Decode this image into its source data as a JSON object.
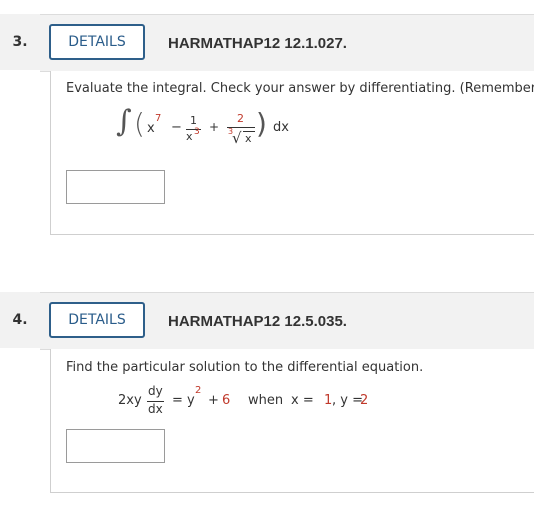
{
  "questions": [
    {
      "number": "3.",
      "details_label": "DETAILS",
      "id": "HARMATHAP12 12.1.027.",
      "prompt": "Evaluate the integral. Check your answer by differentiating. (Remember",
      "integral": {
        "sign": "∫",
        "lparen": "(",
        "rparen": ")",
        "x": "x",
        "exp7": "7",
        "minus": "−",
        "one": "1",
        "x3_base": "x",
        "x3_exp": "3",
        "plus": "+",
        "two": "2",
        "root_index": "3",
        "radical": "√",
        "root_x": "x",
        "dx": "dx"
      }
    },
    {
      "number": "4.",
      "details_label": "DETAILS",
      "id": "HARMATHAP12 12.5.035.",
      "prompt": "Find the particular solution to the differential equation.",
      "equation": {
        "lhs": "2xy",
        "dy": "dy",
        "dx": "dx",
        "eq": "=",
        "y": "y",
        "exp": "2",
        "plus": "+",
        "six": "6",
        "when": "when",
        "x_eq": "x = ",
        "x_val": "1",
        "comma": ", y = ",
        "y_val": "2"
      }
    }
  ],
  "colors": {
    "accent": "#2e5f8a",
    "red_value": "#c0392b",
    "header_bg": "#f2f2f2"
  }
}
